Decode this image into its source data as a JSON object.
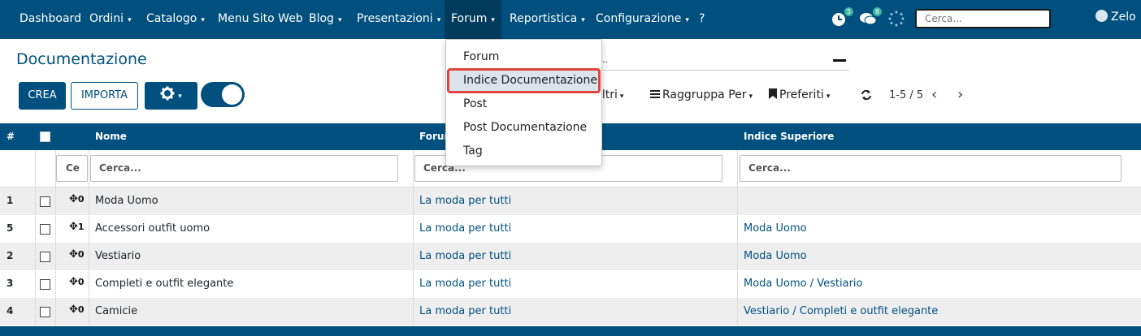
{
  "nav": {
    "items": [
      {
        "label": "Dashboard",
        "caret": false
      },
      {
        "label": "Ordini",
        "caret": true
      },
      {
        "label": "Catalogo",
        "caret": true
      },
      {
        "label": "Menu Sito Web",
        "caret": false
      },
      {
        "label": "Blog",
        "caret": true
      },
      {
        "label": "Presentazioni",
        "caret": true
      },
      {
        "label": "Forum",
        "caret": true,
        "active": true
      },
      {
        "label": "Reportistica",
        "caret": true
      },
      {
        "label": "Configurazione",
        "caret": true
      },
      {
        "label": "?",
        "caret": false
      }
    ],
    "caret_glyph": "▾",
    "activity_badge": "5",
    "messages_badge": "8",
    "search_placeholder": "Cerca...",
    "user_name": "Zelo"
  },
  "page": {
    "title": "Documentazione",
    "create_label": "CREA",
    "import_label": "IMPORTA",
    "filters_label": "iltri",
    "groupby_label": "Raggruppa Per",
    "favorites_label": "Preferiti",
    "pager": "1-5 / 5",
    "search_remnant": "..."
  },
  "forum_menu": {
    "items": [
      "Forum",
      "Indice Documentazione",
      "Post",
      "Post Documentazione",
      "Tag"
    ],
    "highlighted": "Indice Documentazione"
  },
  "table": {
    "headers": {
      "num": "#",
      "name": "Nome",
      "forum": "Forum",
      "parent": "Indice Superiore"
    },
    "filters": {
      "seq": "Ce",
      "name": "Cerca...",
      "forum": "Cerca...",
      "parent": "Cerca..."
    },
    "rows": [
      {
        "num": "1",
        "seq": "0",
        "name": "Moda Uomo",
        "forum": "La moda per tutti",
        "parent": ""
      },
      {
        "num": "5",
        "seq": "1",
        "name": "Accessori outfit uomo",
        "forum": "La moda per tutti",
        "parent": "Moda Uomo"
      },
      {
        "num": "2",
        "seq": "0",
        "name": "Vestiario",
        "forum": "La moda per tutti",
        "parent": "Moda Uomo"
      },
      {
        "num": "3",
        "seq": "0",
        "name": "Completi e outfit elegante",
        "forum": "La moda per tutti",
        "parent": "Moda Uomo / Vestiario"
      },
      {
        "num": "4",
        "seq": "0",
        "name": "Camicie",
        "forum": "La moda per tutti",
        "parent": "Vestiario / Completi e outfit elegante"
      }
    ]
  },
  "colors": {
    "brand": "#00507f",
    "highlight_border": "#e0443e"
  }
}
